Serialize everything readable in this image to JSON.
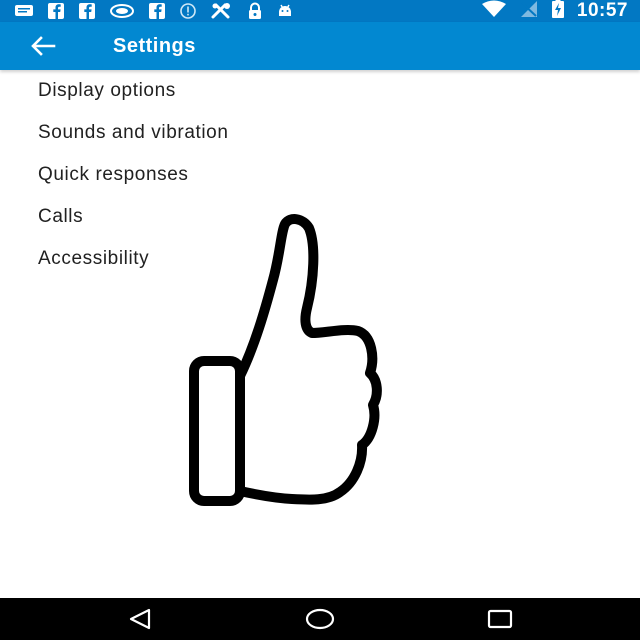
{
  "status_bar": {
    "time": "10:57",
    "icons_left": [
      "message-icon",
      "facebook-icon",
      "facebook-icon",
      "cloud-icon",
      "facebook-icon",
      "alert-circle-icon",
      "crossed-tools-icon",
      "lock-icon",
      "android-icon"
    ],
    "icons_right": [
      "wifi-icon",
      "cellular-no-signal-icon",
      "battery-charging-icon"
    ],
    "background": "#0278c3"
  },
  "app_bar": {
    "title": "Settings",
    "background": "#0288d1"
  },
  "settings": {
    "items": [
      {
        "label": "Display options"
      },
      {
        "label": "Sounds and vibration"
      },
      {
        "label": "Quick responses"
      },
      {
        "label": "Calls"
      },
      {
        "label": "Accessibility"
      }
    ]
  },
  "overlay": {
    "icon": "thumbs-up-icon",
    "color": "#000000"
  },
  "nav_bar": {
    "buttons": [
      "back-triangle-icon",
      "home-circle-icon",
      "recents-square-icon"
    ],
    "background": "#000000"
  }
}
